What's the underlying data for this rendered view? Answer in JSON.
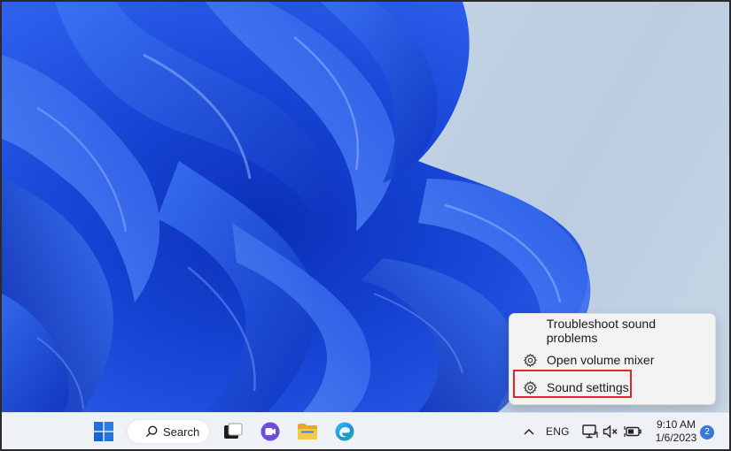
{
  "context_menu": {
    "items": [
      {
        "label": "Troubleshoot sound problems",
        "icon": ""
      },
      {
        "label": "Open volume mixer",
        "icon": "gear-icon"
      },
      {
        "label": "Sound settings",
        "icon": "gear-icon"
      }
    ],
    "highlighted_item": "Sound settings",
    "highlight_color": "#e0262b"
  },
  "taskbar": {
    "search_label": "Search",
    "language": "ENG",
    "time": "9:10 AM",
    "date": "1/6/2023",
    "notification_count": "2",
    "accent_color": "#3a78d8",
    "icons": [
      "windows-start-icon",
      "search-icon",
      "task-view-icon",
      "chat-icon",
      "file-explorer-icon",
      "edge-icon",
      "chevron-up-icon",
      "network-icon",
      "volume-muted-icon",
      "battery-icon"
    ]
  },
  "colors": {
    "wallpaper_blue": "#1f4fe0",
    "wallpaper_background": "#c3d3e5",
    "taskbar_background": "#eef1f6",
    "menu_background": "#f3f3f3"
  }
}
